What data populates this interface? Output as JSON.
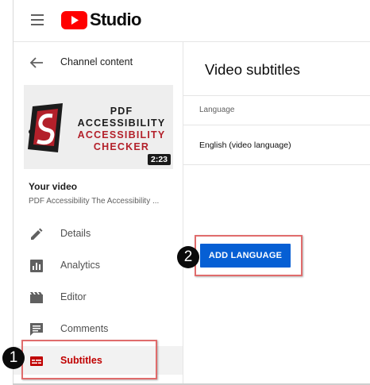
{
  "header": {
    "logo_text": "Studio",
    "menu_icon": "hamburger-menu-icon",
    "logo_icon": "youtube-play-icon",
    "brand_color": "#ff0000"
  },
  "sidebar": {
    "back_label": "Channel content",
    "back_icon": "arrow-left-icon",
    "thumbnail": {
      "lines": [
        "PDF",
        "ACCESSIBILITY",
        "ACCESSIBILITY",
        "CHECKER"
      ],
      "duration": "2:23"
    },
    "your_video_label": "Your video",
    "video_title": "PDF Accessibility The Accessibility ...",
    "items": [
      {
        "label": "Details",
        "icon": "pencil-icon"
      },
      {
        "label": "Analytics",
        "icon": "bar-chart-icon"
      },
      {
        "label": "Editor",
        "icon": "clapperboard-icon"
      },
      {
        "label": "Comments",
        "icon": "comment-icon"
      },
      {
        "label": "Subtitles",
        "icon": "subtitles-icon",
        "active": true
      }
    ]
  },
  "main": {
    "title": "Video subtitles",
    "column_header": "Language",
    "languages": [
      "English (video language)"
    ],
    "add_button": "ADD LANGUAGE",
    "accent_color": "#065fd4"
  },
  "annotations": {
    "step1": "1",
    "step2": "2",
    "highlight_color": "#e06c6c"
  }
}
